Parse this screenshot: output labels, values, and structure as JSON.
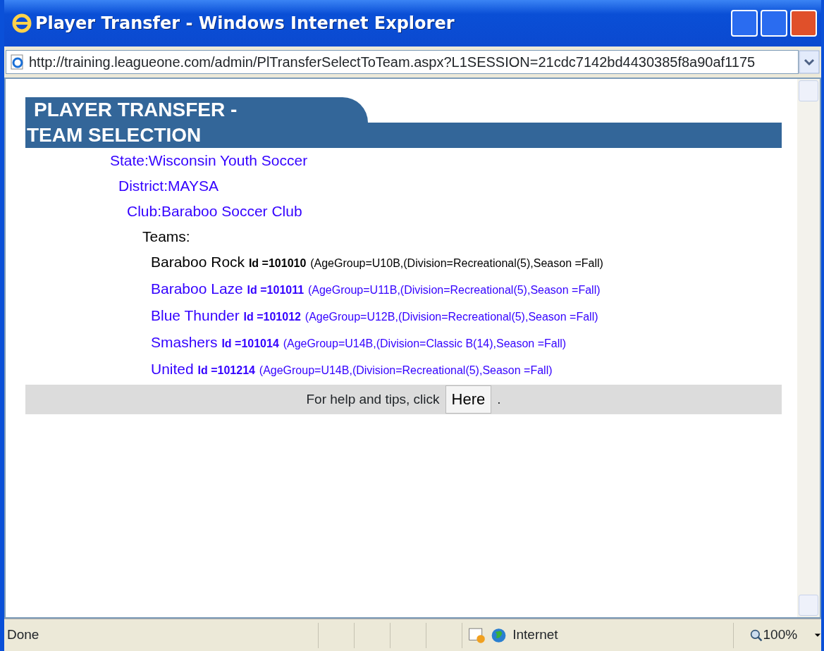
{
  "window": {
    "title": "Player Transfer - Windows Internet Explorer"
  },
  "address_bar": {
    "url": "http://training.leagueone.com/admin/PlTransferSelectToTeam.aspx?L1SESSION=21cdc7142bd4430385f8a90af1175"
  },
  "page": {
    "heading_line_1": "PLAYER TRANSFER -",
    "heading_line_2": "TEAM SELECTION",
    "state": "State:Wisconsin Youth Soccer",
    "district": "District:MAYSA",
    "club": "Club:Baraboo Soccer Club",
    "teams_label": "Teams:",
    "teams": [
      {
        "name": "Baraboo Rock",
        "id": "Id =101010",
        "details": "(AgeGroup=U10B,(Division=Recreational(5),Season =Fall)",
        "current": true
      },
      {
        "name": "Baraboo Laze",
        "id": "Id =101011",
        "details": "(AgeGroup=U11B,(Division=Recreational(5),Season =Fall)",
        "current": false
      },
      {
        "name": "Blue Thunder",
        "id": "Id =101012",
        "details": "(AgeGroup=U12B,(Division=Recreational(5),Season =Fall)",
        "current": false
      },
      {
        "name": "Smashers",
        "id": "Id =101014",
        "details": "(AgeGroup=U14B,(Division=Classic B(14),Season =Fall)",
        "current": false
      },
      {
        "name": "United",
        "id": "Id =101214",
        "details": "(AgeGroup=U14B,(Division=Recreational(5),Season =Fall)",
        "current": false
      }
    ],
    "help_text": "For help and tips, click",
    "help_button": "Here",
    "help_period": "."
  },
  "status_bar": {
    "status": "Done",
    "zone": "Internet",
    "zoom": "100%"
  }
}
